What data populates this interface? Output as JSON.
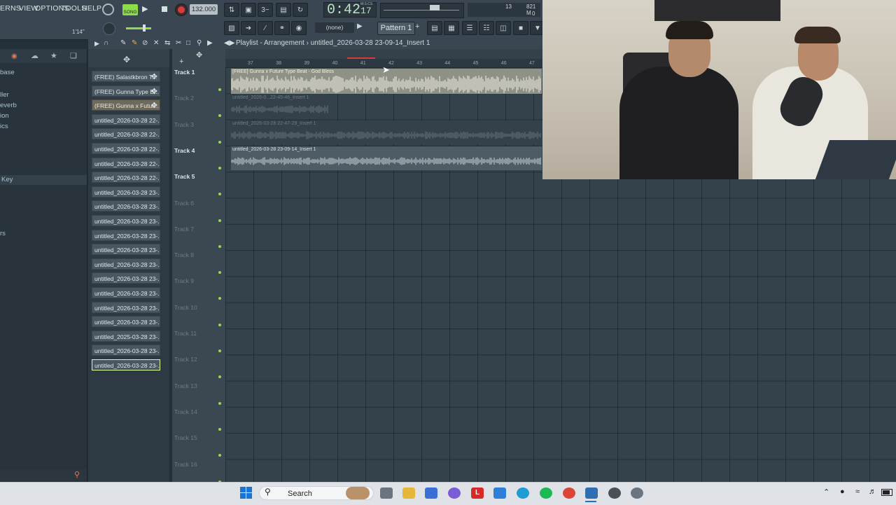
{
  "menu": [
    "ERNS",
    "VIEW",
    "OPTIONS",
    "TOOLS",
    "HELP"
  ],
  "transport": {
    "song_mode_label": "SONG",
    "tempo": "132.000",
    "time": "0:42",
    "time_frac": "17",
    "time_unit_label": "M:S:CS"
  },
  "cpu": {
    "value": "13",
    "mem": "821 M",
    "zero": "0"
  },
  "pattern_selector": {
    "none_label": "(none)",
    "pattern_label": "Pattern 1"
  },
  "counter_label": "1'14\"",
  "playlist": {
    "title_prefix": "Playlist - Arrangement",
    "title_file": "untitled_2026-03-28 23-09-14_Insert 1",
    "ruler": [
      "37",
      "38",
      "39",
      "40",
      "41",
      "42",
      "43",
      "44",
      "45",
      "46",
      "47"
    ]
  },
  "browser": {
    "items": [
      "base",
      "ller",
      "everb",
      "ion",
      "ics",
      "Key",
      "rs"
    ]
  },
  "channels": [
    {
      "label": "(FREE) Salastkbron T...",
      "style": "normal"
    },
    {
      "label": "(FREE) Gunna Type B...",
      "style": "normal"
    },
    {
      "label": "(FREE) Gunna x Futur...",
      "style": "beige"
    },
    {
      "label": "untitled_2026-03-28 22-...",
      "style": "normal"
    },
    {
      "label": "untitled_2026-03-28 22-...",
      "style": "normal"
    },
    {
      "label": "untitled_2026-03-28 22-...",
      "style": "normal"
    },
    {
      "label": "untitled_2026-03-28 22-...",
      "style": "normal"
    },
    {
      "label": "untitled_2026-03-28 22-...",
      "style": "normal"
    },
    {
      "label": "untitled_2026-03-28 23-...",
      "style": "normal"
    },
    {
      "label": "untitled_2026-03-28 23-...",
      "style": "normal"
    },
    {
      "label": "untitled_2026-03-28 23-...",
      "style": "normal"
    },
    {
      "label": "untitled_2026-03-28 23-...",
      "style": "normal"
    },
    {
      "label": "untitled_2026-03-28 23-...",
      "style": "normal"
    },
    {
      "label": "untitled_2026-03-28 23-...",
      "style": "normal"
    },
    {
      "label": "untitled_2026-03-28 23-...",
      "style": "normal"
    },
    {
      "label": "untitled_2026-03-28 23-...",
      "style": "normal"
    },
    {
      "label": "untitled_2026-03-28 23-...",
      "style": "normal"
    },
    {
      "label": "untitled_2026-03-28 23-...",
      "style": "normal"
    },
    {
      "label": "untitled_2025-03-28 23-...",
      "style": "normal"
    },
    {
      "label": "untitled_2026-03-28 23-...",
      "style": "normal"
    },
    {
      "label": "untitled_2026-03-28 23-...",
      "style": "selected"
    }
  ],
  "tracks": [
    {
      "label": "Track 1",
      "active": true
    },
    {
      "label": "Track 2",
      "active": false
    },
    {
      "label": "Track 3",
      "active": false
    },
    {
      "label": "Track 4",
      "active": true
    },
    {
      "label": "Track 5",
      "active": true
    },
    {
      "label": "Track 6",
      "active": false
    },
    {
      "label": "Track 7",
      "active": false
    },
    {
      "label": "Track 8",
      "active": false
    },
    {
      "label": "Track 9",
      "active": false
    },
    {
      "label": "Track 10",
      "active": false
    },
    {
      "label": "Track 11",
      "active": false
    },
    {
      "label": "Track 12",
      "active": false
    },
    {
      "label": "Track 13",
      "active": false
    },
    {
      "label": "Track 14",
      "active": false
    },
    {
      "label": "Track 15",
      "active": false
    },
    {
      "label": "Track 16",
      "active": false
    }
  ],
  "clips": [
    {
      "label": "[FREE] Gunna x Future Type Beat - God Bless",
      "style": "light"
    },
    {
      "label": "untitled_2026-0...22-45-46_Insert 1",
      "style": "ghost"
    },
    {
      "label": "untitled_2026-03-28 22-47-29_Insert 1",
      "style": "ghost"
    },
    {
      "label": "untitled_2026-03-28 23-09-14_Insert 1",
      "style": "normal"
    }
  ],
  "taskbar": {
    "search_placeholder": "Search"
  },
  "colors": {
    "accent_green": "#8fdc4a",
    "selected_outline": "#d8ff9c",
    "record_red": "#d93a3a"
  }
}
